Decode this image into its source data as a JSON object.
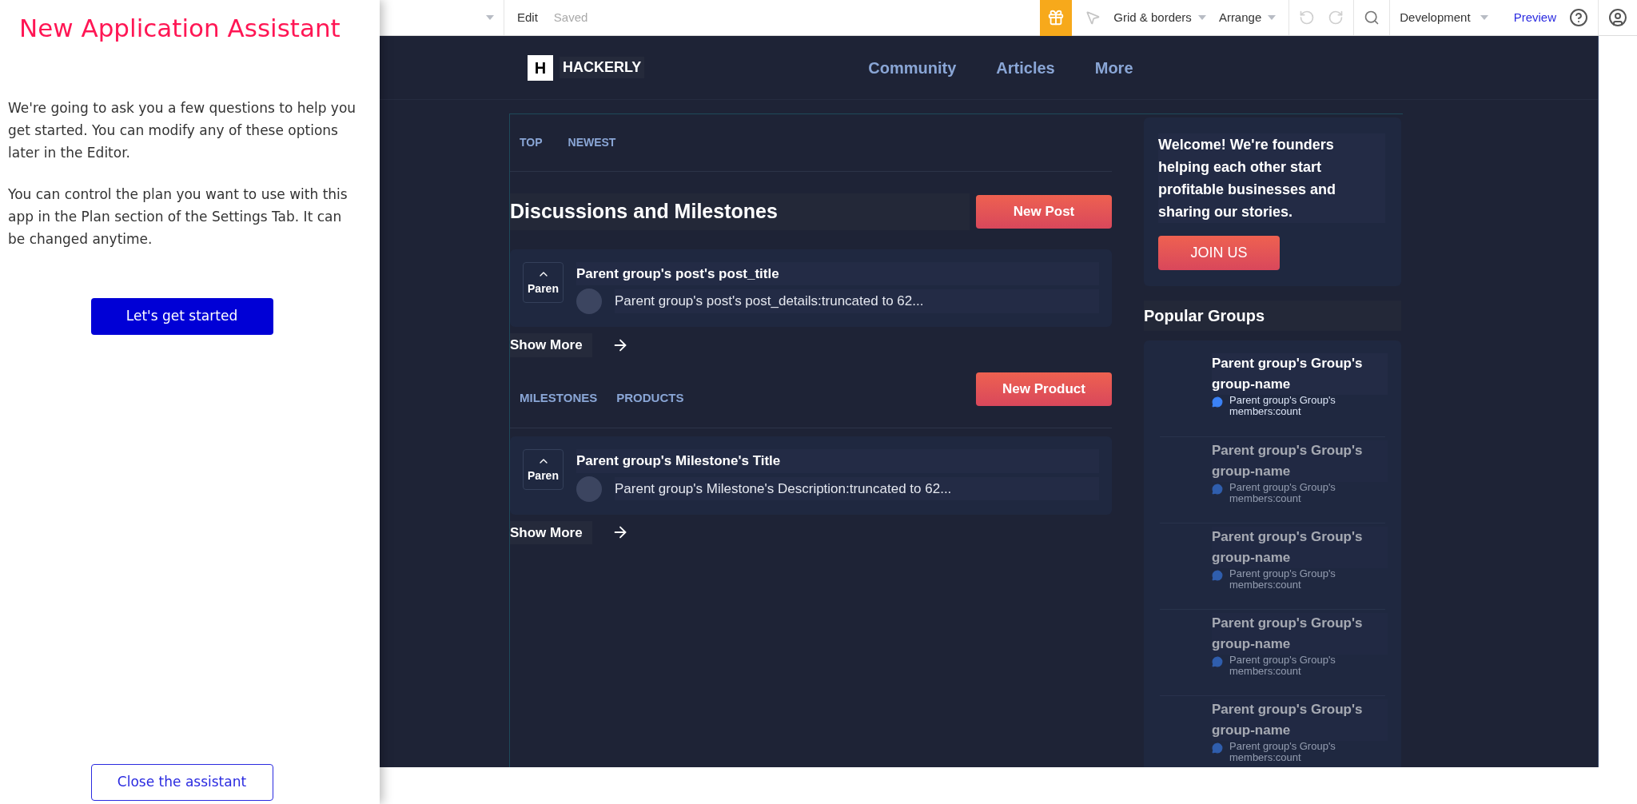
{
  "assistant": {
    "title": "New Application Assistant",
    "paragraphs": [
      "We're going to ask you a few questions to help you get started. You can modify any of these options later in the Editor.",
      "You can control the plan you want to use with this app in the Plan section of the Settings Tab. It can be changed anytime."
    ],
    "start_button": "Let's get started",
    "close_button": "Close the assistant"
  },
  "toolbar": {
    "edit": "Edit",
    "status": "Saved",
    "menus": [
      "Grid & borders",
      "Arrange"
    ],
    "environment": "Development",
    "preview": "Preview"
  },
  "site": {
    "logo_letter": "H",
    "brand": "HACKERLY",
    "nav": [
      "Community",
      "Articles",
      "More"
    ]
  },
  "discussions": {
    "tabs": [
      "TOP",
      "NEWEST"
    ],
    "title": "Discussions and Milestones",
    "button": "New Post",
    "items": [
      {
        "vote": "Paren",
        "title": "Parent group's post's post_title",
        "details": "Parent group's post's post_details:truncated to 62..."
      }
    ],
    "show_more": "Show More"
  },
  "milestones": {
    "tabs": [
      "MILESTONES",
      "PRODUCTS"
    ],
    "button": "New Product",
    "items": [
      {
        "vote": "Paren",
        "title": "Parent group's Milestone's Title",
        "details": "Parent group's Milestone's Description:truncated to 62..."
      }
    ],
    "show_more": "Show More"
  },
  "welcome": {
    "text": "Welcome! We're founders helping each other start profitable businesses and sharing our stories.",
    "button": "JOIN US"
  },
  "popular_groups": {
    "title": "Popular Groups",
    "groups": [
      {
        "name": "Parent group's Group's group-name",
        "members": "Parent group's Group's members:count",
        "faded": false
      },
      {
        "name": "Parent group's Group's group-name",
        "members": "Parent group's Group's members:count",
        "faded": true
      },
      {
        "name": "Parent group's Group's group-name",
        "members": "Parent group's Group's members:count",
        "faded": true
      },
      {
        "name": "Parent group's Group's group-name",
        "members": "Parent group's Group's members:count",
        "faded": true
      },
      {
        "name": "Parent group's Group's group-name",
        "members": "Parent group's Group's members:count",
        "faded": true
      }
    ]
  }
}
